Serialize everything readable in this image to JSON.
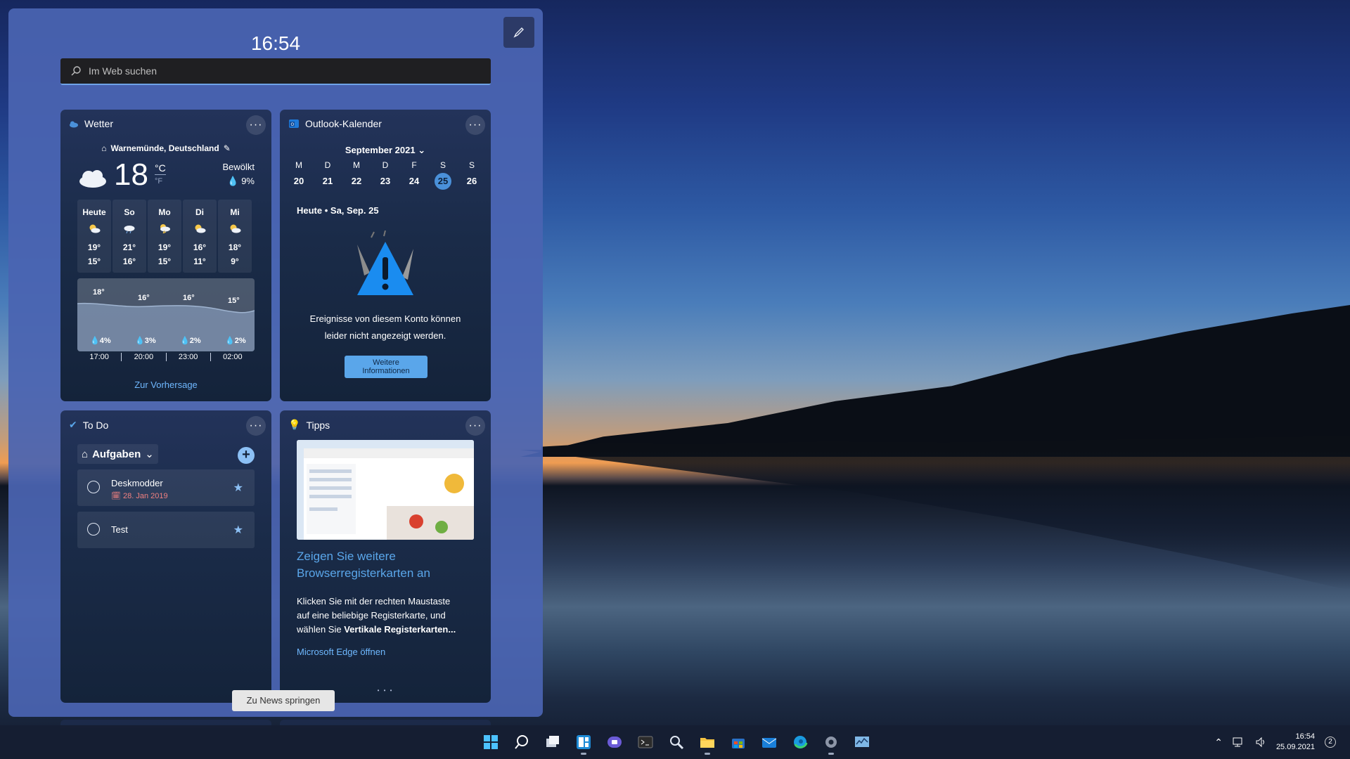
{
  "widgets": {
    "clock": "16:54",
    "search_placeholder": "Im Web suchen"
  },
  "weather": {
    "title": "Wetter",
    "location": "Warnemünde, Deutschland",
    "temp": "18",
    "unit_c": "°C",
    "unit_f": "°F",
    "condition": "Bewölkt",
    "precip": "9%",
    "days": [
      {
        "name": "Heute",
        "hi": "19°",
        "lo": "15°"
      },
      {
        "name": "So",
        "hi": "21°",
        "lo": "16°"
      },
      {
        "name": "Mo",
        "hi": "19°",
        "lo": "15°"
      },
      {
        "name": "Di",
        "hi": "16°",
        "lo": "11°"
      },
      {
        "name": "Mi",
        "hi": "18°",
        "lo": "9°"
      }
    ],
    "hourly": [
      {
        "time": "17:00",
        "temp": "18°",
        "precip": "4%"
      },
      {
        "time": "20:00",
        "temp": "16°",
        "precip": "3%"
      },
      {
        "time": "23:00",
        "temp": "16°",
        "precip": "2%"
      },
      {
        "time": "02:00",
        "temp": "15°",
        "precip": "2%"
      }
    ],
    "forecast_link": "Zur Vorhersage"
  },
  "calendar": {
    "title": "Outlook-Kalender",
    "month": "September 2021",
    "weekdays": [
      "M",
      "D",
      "M",
      "D",
      "F",
      "S",
      "S"
    ],
    "dates": [
      "20",
      "21",
      "22",
      "23",
      "24",
      "25",
      "26"
    ],
    "selected_index": 5,
    "today": "Heute • Sa, Sep. 25",
    "message_line1": "Ereignisse von diesem Konto können",
    "message_line2": "leider nicht angezeigt werden.",
    "button_line1": "Weitere",
    "button_line2": "Informationen"
  },
  "todo": {
    "title": "To Do",
    "list_name": "Aufgaben",
    "items": [
      {
        "title": "Deskmodder",
        "date": "28. Jan 2019"
      },
      {
        "title": "Test",
        "date": ""
      }
    ]
  },
  "tips": {
    "title": "Tipps",
    "headline_line1": "Zeigen Sie weitere",
    "headline_line2": "Browserregisterkarten an",
    "body_line1": "Klicken Sie mit der rechten Maustaste",
    "body_line2": "auf eine beliebige Registerkarte, und",
    "body_line3_prefix": "wählen Sie ",
    "body_line3_bold": "Vertikale Registerkarten...",
    "link": "Microsoft Edge öffnen",
    "dots": "• • •"
  },
  "tooltip": "Zu News springen",
  "taskbar": {
    "icons": [
      "windows-start-icon",
      "search-icon",
      "task-view-icon",
      "widgets-icon",
      "teams-chat-icon",
      "terminal-icon",
      "magnifier-icon",
      "file-explorer-icon",
      "store-icon",
      "mail-icon",
      "edge-icon",
      "settings-icon",
      "resource-monitor-icon"
    ],
    "time": "16:54",
    "date": "25.09.2021",
    "notifications": "2"
  },
  "colors": {
    "accent": "#5aa6ea",
    "panel": "#4a64b2",
    "card": "#1a2b48",
    "todo_date": "#f08080"
  }
}
